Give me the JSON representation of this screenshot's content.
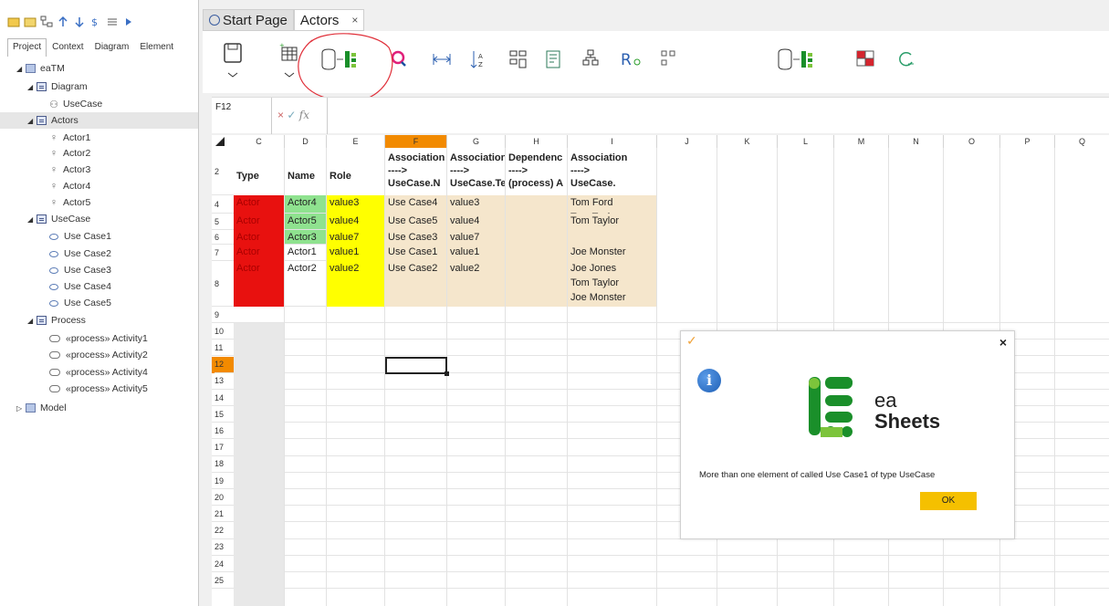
{
  "left_panel": {
    "tabs": [
      "Project",
      "Context",
      "Diagram",
      "Element"
    ],
    "tree": [
      {
        "label": "eaTM",
        "kind": "model",
        "level": 0,
        "expanded": true
      },
      {
        "label": "Diagram",
        "kind": "package",
        "level": 1,
        "expanded": true
      },
      {
        "label": "UseCase",
        "kind": "diagram",
        "level": 2
      },
      {
        "label": "Actors",
        "kind": "package",
        "level": 1,
        "expanded": true,
        "selected": true
      },
      {
        "label": "Actor1",
        "kind": "actor",
        "level": 2
      },
      {
        "label": "Actor2",
        "kind": "actor",
        "level": 2
      },
      {
        "label": "Actor3",
        "kind": "actor",
        "level": 2
      },
      {
        "label": "Actor4",
        "kind": "actor",
        "level": 2
      },
      {
        "label": "Actor5",
        "kind": "actor",
        "level": 2
      },
      {
        "label": "UseCase",
        "kind": "package",
        "level": 1,
        "expanded": true
      },
      {
        "label": "Use Case1",
        "kind": "usecase",
        "level": 2
      },
      {
        "label": "Use Case2",
        "kind": "usecase",
        "level": 2
      },
      {
        "label": "Use Case3",
        "kind": "usecase",
        "level": 2
      },
      {
        "label": "Use Case4",
        "kind": "usecase",
        "level": 2
      },
      {
        "label": "Use Case5",
        "kind": "usecase",
        "level": 2
      },
      {
        "label": "Process",
        "kind": "package",
        "level": 1,
        "expanded": true
      },
      {
        "label": "«process» Activity1",
        "kind": "activity",
        "level": 2
      },
      {
        "label": "«process» Activity2",
        "kind": "activity",
        "level": 2
      },
      {
        "label": "«process» Activity4",
        "kind": "activity",
        "level": 2
      },
      {
        "label": "«process» Activity5",
        "kind": "activity",
        "level": 2
      },
      {
        "label": "Model",
        "kind": "model",
        "level": 0,
        "expanded": false
      }
    ]
  },
  "doc_tabs": [
    {
      "label": "Start Page",
      "active": false
    },
    {
      "label": "Actors",
      "active": true
    }
  ],
  "formula_bar": {
    "cell_ref": "F12",
    "icons": "× ✓ fx"
  },
  "grid": {
    "columns": [
      "C",
      "D",
      "E",
      "F",
      "G",
      "H",
      "I",
      "J",
      "K",
      "L",
      "M",
      "N",
      "O",
      "P",
      "Q"
    ],
    "active_column": "F",
    "active_row": "12",
    "header_row_label": "2",
    "headers": {
      "C": "Type",
      "D": "Name",
      "E": "Role",
      "F": "Association\n---->\nUseCase.N",
      "G": "Association\n---->\nUseCase.Te",
      "H": "Dependenc\n---->\n(process) A",
      "I": "Association\n---->\nUseCase."
    },
    "rows": [
      {
        "row": "4",
        "C": "Actor",
        "D": "Actor4",
        "E": "value3",
        "F": "Use Case4",
        "G": "value3",
        "H": "",
        "I": "Tom Ford\nTom Taylor"
      },
      {
        "row": "5",
        "C": "Actor",
        "D": "Actor5",
        "E": "value4",
        "F": "Use Case5",
        "G": "value4",
        "H": "",
        "I": "Tom Taylor"
      },
      {
        "row": "6",
        "C": "Actor",
        "D": "Actor3",
        "E": "value7",
        "F": "Use Case3",
        "G": "value7",
        "H": "",
        "I": ""
      },
      {
        "row": "7",
        "C": "Actor",
        "D": "Actor1",
        "E": "value1",
        "F": "Use Case1",
        "G": "value1",
        "H": "",
        "I": "Joe Monster"
      },
      {
        "row": "8",
        "C": "Actor",
        "D": "Actor2",
        "E": "value2",
        "F": "Use Case2",
        "G": "value2",
        "H": "",
        "I": "Joe Jones\nTom Taylor\nJoe Monster"
      }
    ],
    "empty_rows": [
      "9",
      "10",
      "11",
      "12",
      "13",
      "14",
      "15",
      "16",
      "17",
      "18",
      "19",
      "20",
      "21",
      "22",
      "23",
      "24",
      "25"
    ]
  },
  "colors": {
    "actor_red": "#e8110f",
    "name_green": "#8fe28f",
    "role_yellow": "#ffff00",
    "assoc_beige": "#f5e6cc",
    "active_header": "#f28a00",
    "annotation_red": "#e0303a",
    "ok_yellow": "#f5c000"
  },
  "dialog": {
    "logo_line1": "ea",
    "logo_line2": "Sheets",
    "message": "More than one element of called Use Case1 of type UseCase",
    "ok_label": "OK",
    "close_label": "×"
  }
}
